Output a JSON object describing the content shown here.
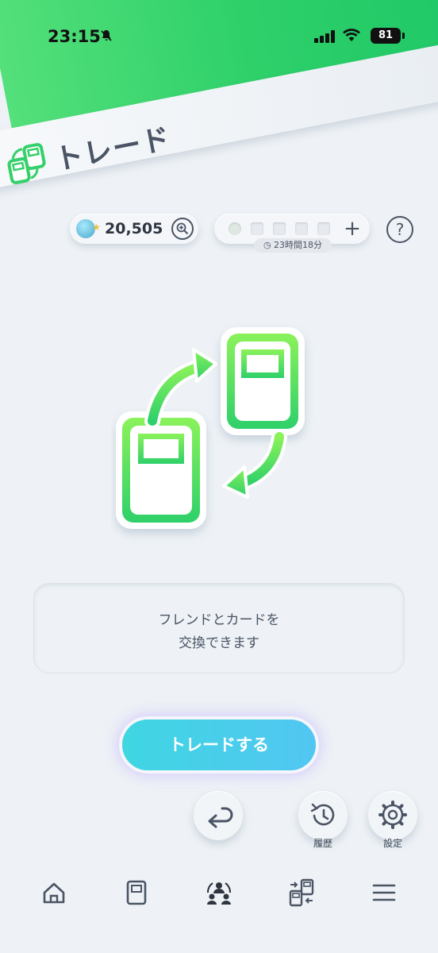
{
  "status_bar": {
    "time": "23:15",
    "battery": "81"
  },
  "header": {
    "title": "トレード"
  },
  "currency": {
    "value": "20,505"
  },
  "stamina": {
    "timer": "23時間18分",
    "slots_total": 6,
    "slots_filled": 0
  },
  "description": {
    "line1": "フレンドとカードを",
    "line2": "交換できます"
  },
  "actions": {
    "trade_label": "トレードする",
    "history_label": "履歴",
    "settings_label": "設定"
  },
  "nav": {
    "items": [
      "home-icon",
      "card-album-icon",
      "social-icon",
      "trade-icon",
      "menu-icon"
    ]
  },
  "colors": {
    "accent_green": "#2ed06a",
    "trade_button": "#46cfe8",
    "text_dark": "#4a5464"
  }
}
